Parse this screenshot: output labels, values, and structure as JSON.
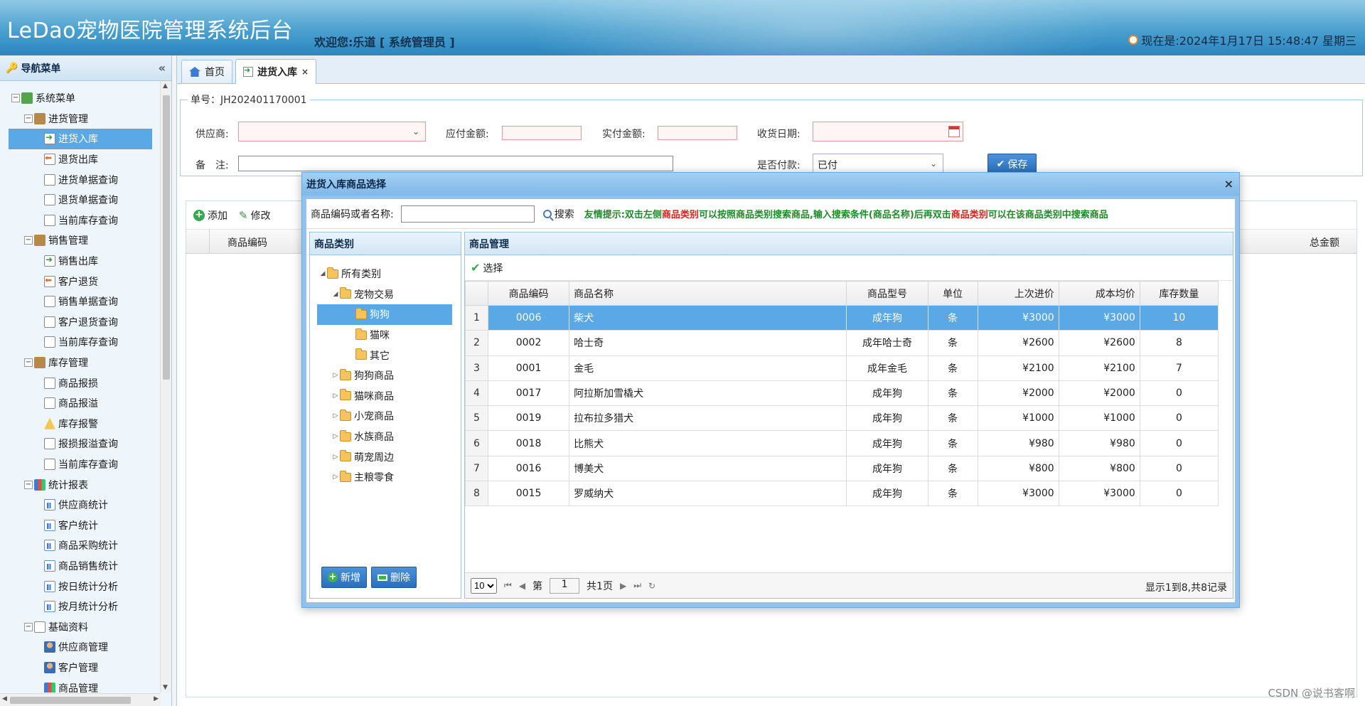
{
  "header": {
    "app_title": "LeDao宠物医院管理系统后台",
    "welcome": "欢迎您:乐道 [ 系统管理员 ]",
    "clock": "现在是:2024年1月17日 15:48:47 星期三"
  },
  "sidebar": {
    "title": "导航菜单",
    "collapse": "«",
    "root": "系统菜单",
    "groups": [
      {
        "label": "进货管理",
        "items": [
          "进货入库",
          "退货出库",
          "进货单据查询",
          "退货单据查询",
          "当前库存查询"
        ]
      },
      {
        "label": "销售管理",
        "items": [
          "销售出库",
          "客户退货",
          "销售单据查询",
          "客户退货查询",
          "当前库存查询"
        ]
      },
      {
        "label": "库存管理",
        "items": [
          "商品报损",
          "商品报溢",
          "库存报警",
          "报损报溢查询",
          "当前库存查询"
        ]
      },
      {
        "label": "统计报表",
        "items": [
          "供应商统计",
          "客户统计",
          "商品采购统计",
          "商品销售统计",
          "按日统计分析",
          "按月统计分析"
        ]
      },
      {
        "label": "基础资料",
        "items": [
          "供应商管理",
          "客户管理",
          "商品管理"
        ]
      }
    ]
  },
  "tabs": [
    {
      "label": "首页"
    },
    {
      "label": "进货入库",
      "close": "×"
    }
  ],
  "order_form": {
    "legend": "单号：JH202401170001",
    "supplier_label": "供应商:",
    "payable_label": "应付金额:",
    "paid_label": "实付金额:",
    "receive_date_label": "收货日期:",
    "remark_label": "备　注:",
    "is_paid_label": "是否付款:",
    "is_paid_value": "已付",
    "save_label": "保存"
  },
  "order_grid": {
    "add_label": "添加",
    "edit_label": "修改",
    "col_code": "商品编码",
    "col_total": "总金额"
  },
  "dialog": {
    "title": "进货入库商品选择",
    "close": "×",
    "search_label": "商品编码或者名称:",
    "search_button": "搜索",
    "tip_prefix": "友情提示:双击左侧",
    "tip_red1": "商品类别",
    "tip_mid": "可以按照商品类别搜索商品,输入搜索条件(商品名称)后再双击",
    "tip_red2": "商品类别",
    "tip_suffix": "可以在该商品类别中搜索商品",
    "category_title": "商品类别",
    "categories": {
      "root": "所有类别",
      "pet_trade": "宠物交易",
      "dog": "狗狗",
      "cat": "猫咪",
      "other": "其它",
      "groups": [
        "狗狗商品",
        "猫咪商品",
        "小宠商品",
        "水族商品",
        "萌宠周边",
        "主粮零食"
      ]
    },
    "add_button": "新增",
    "delete_button": "删除",
    "goods_title": "商品管理",
    "select_button": "选择",
    "columns": [
      "商品编码",
      "商品名称",
      "商品型号",
      "单位",
      "上次进价",
      "成本均价",
      "库存数量"
    ],
    "rows": [
      {
        "n": "1",
        "code": "0006",
        "name": "柴犬",
        "model": "成年狗",
        "unit": "条",
        "last": "¥3000",
        "avg": "¥3000",
        "qty": "10"
      },
      {
        "n": "2",
        "code": "0002",
        "name": "哈士奇",
        "model": "成年哈士奇",
        "unit": "条",
        "last": "¥2600",
        "avg": "¥2600",
        "qty": "8"
      },
      {
        "n": "3",
        "code": "0001",
        "name": "金毛",
        "model": "成年金毛",
        "unit": "条",
        "last": "¥2100",
        "avg": "¥2100",
        "qty": "7"
      },
      {
        "n": "4",
        "code": "0017",
        "name": "阿拉斯加雪橇犬",
        "model": "成年狗",
        "unit": "条",
        "last": "¥2000",
        "avg": "¥2000",
        "qty": "0"
      },
      {
        "n": "5",
        "code": "0019",
        "name": "拉布拉多猎犬",
        "model": "成年狗",
        "unit": "条",
        "last": "¥1000",
        "avg": "¥1000",
        "qty": "0"
      },
      {
        "n": "6",
        "code": "0018",
        "name": "比熊犬",
        "model": "成年狗",
        "unit": "条",
        "last": "¥980",
        "avg": "¥980",
        "qty": "0"
      },
      {
        "n": "7",
        "code": "0016",
        "name": "博美犬",
        "model": "成年狗",
        "unit": "条",
        "last": "¥800",
        "avg": "¥800",
        "qty": "0"
      },
      {
        "n": "8",
        "code": "0015",
        "name": "罗威纳犬",
        "model": "成年狗",
        "unit": "条",
        "last": "¥3000",
        "avg": "¥3000",
        "qty": "0"
      }
    ],
    "pager": {
      "page_size": "10",
      "page_prefix": "第",
      "page_value": "1",
      "page_suffix": "共1页",
      "info": "显示1到8,共8记录"
    }
  },
  "watermark": "CSDN @说书客啊",
  "colors": {
    "selected": "#5aa9e6",
    "header": "#4aa0cf",
    "tip_green": "#1f8a2a",
    "tip_red": "#e0201a"
  }
}
